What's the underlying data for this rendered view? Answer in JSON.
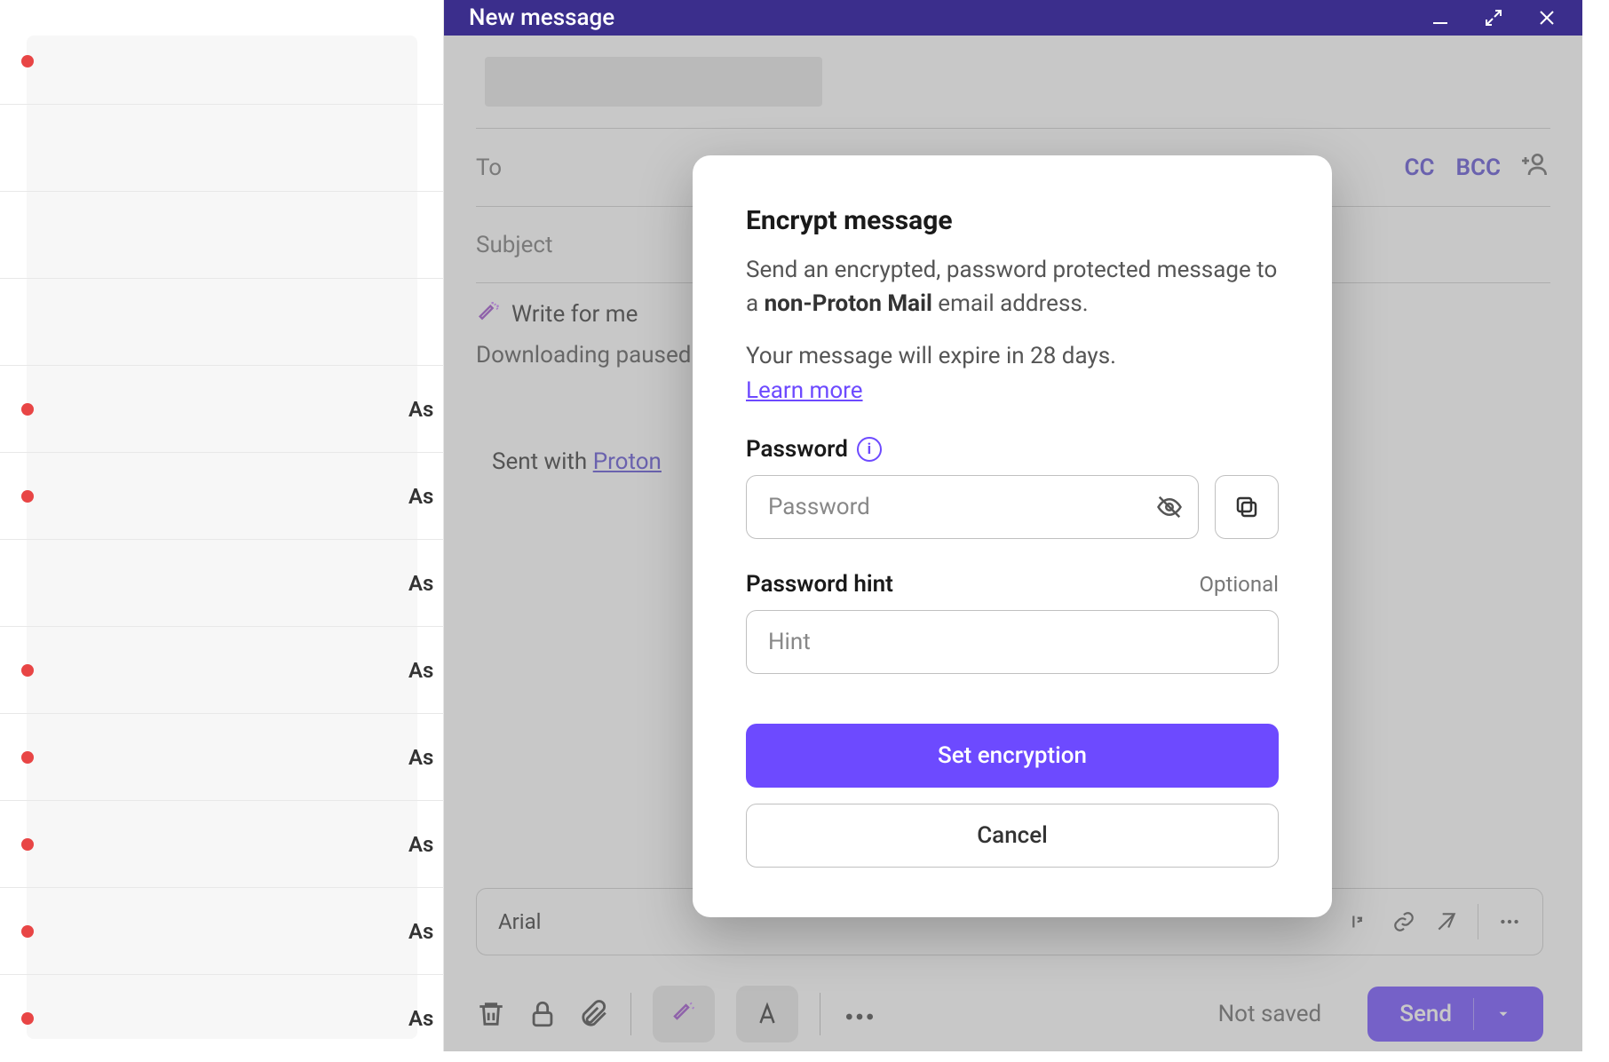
{
  "email_list": {
    "item_prefix": "As"
  },
  "composer": {
    "header_title": "New message",
    "to_label": "To",
    "cc_label": "CC",
    "bcc_label": "BCC",
    "subject_placeholder": "Subject",
    "write_for_me": "Write for me",
    "downloading_status": "Downloading paused",
    "sent_with_prefix": "Sent with ",
    "sent_with_link": "Proton",
    "font_name": "Arial",
    "not_saved": "Not saved",
    "send_label": "Send"
  },
  "modal": {
    "title": "Encrypt message",
    "desc_pre": "Send an encrypted, password protected message to a ",
    "desc_bold": "non-Proton Mail",
    "desc_post": " email address.",
    "expiry_text": "Your message will expire in 28 days.",
    "learn_more": "Learn more",
    "password_label": "Password",
    "password_placeholder": "Password",
    "hint_label": "Password hint",
    "hint_optional": "Optional",
    "hint_placeholder": "Hint",
    "set_button": "Set encryption",
    "cancel_button": "Cancel"
  }
}
